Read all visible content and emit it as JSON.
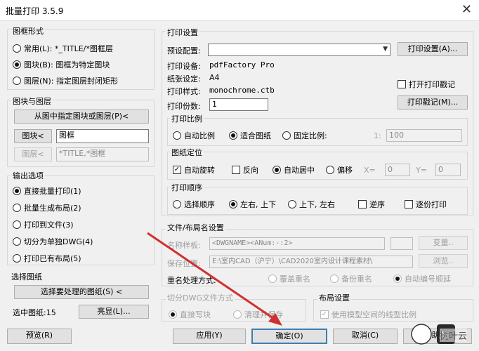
{
  "window": {
    "title": "批量打印 3.5.9",
    "close": "✕"
  },
  "frame": {
    "title": "图框形式",
    "opt1": "常用(L): *_TITLE/*图框层",
    "opt2": "图块(B): 图框为特定图块",
    "opt3": "图层(N): 指定图层封闭矩形"
  },
  "blocks": {
    "title": "图块与图层",
    "pick_btn": "从图中指定图块或图层(P)<",
    "block_btn": "图块<",
    "block_val": "图框",
    "layer_btn": "图层<",
    "layer_val": "*TITLE,*图框"
  },
  "output": {
    "title": "输出选项",
    "o1": "直接批量打印(1)",
    "o2": "批量生成布局(2)",
    "o3": "打印到文件(3)",
    "o4": "切分为单独DWG(4)",
    "o5": "打印已有布局(5)"
  },
  "select": {
    "title": "选择图纸",
    "btn": "选择要处理的图纸(S) <",
    "count_label": "选中图纸:15",
    "preview_btn": "亮显(L)..."
  },
  "print": {
    "title": "打印设置",
    "preset_label": "预设配置:",
    "setup_btn": "打印设置(A)...",
    "device_label": "打印设备:",
    "device_val": "pdfFactory Pro",
    "paper_label": "纸张设定:",
    "paper_val": "A4",
    "style_label": "打印样式:",
    "style_val": "monochrome.ctb",
    "stamp_chk": "打开打印戳记",
    "copies_label": "打印份数:",
    "copies_val": "1",
    "stamp_btn": "打印戳记(M)..."
  },
  "scale": {
    "title": "打印比例",
    "auto": "自动比例",
    "fit": "适合图纸",
    "fixed": "固定比例:",
    "ratio_pre": "1:",
    "ratio_val": "100"
  },
  "position": {
    "title": "图纸定位",
    "rotate": "自动旋转",
    "reverse": "反向",
    "center": "自动居中",
    "offset": "偏移",
    "x_label": "X=",
    "x_val": "0",
    "y_label": "Y=",
    "y_val": "0"
  },
  "order": {
    "title": "打印顺序",
    "select_order": "选择顺序",
    "lr_tb": "左右, 上下",
    "tb_lr": "上下, 左右",
    "reverse": "逆序",
    "reverse_print": "逐份打印"
  },
  "naming": {
    "title": "文件/布局名设置",
    "name_label": "名称样板:",
    "name_val": "<DWGNAME><ANum:-:2>",
    "var_btn": "变量..",
    "path_label": "保存位置:",
    "path_val": "E:\\室内CAD（沪宁）\\CAD2020室内设计课程素材\\",
    "browse_btn": "浏览..",
    "dup_label": "重名处理方式:",
    "dup1": "覆盖重名",
    "dup2": "备份重名",
    "dup3": "自动编号顺延"
  },
  "split": {
    "title": "切分DWG文件方式",
    "o1": "直接写块",
    "o2": "清理并保存"
  },
  "layout": {
    "title": "布局设置",
    "chk": "使用模型空间的线型比例"
  },
  "footer": {
    "preview": "预览(R)",
    "apply": "应用(Y)",
    "ok": "确定(O)",
    "cancel": "取消(C)",
    "help": "帮助(H)"
  },
  "watermark": {
    "brand": "树叶云"
  },
  "colors": {
    "arrow": "#d03030",
    "default_border": "#3c7fb1"
  }
}
